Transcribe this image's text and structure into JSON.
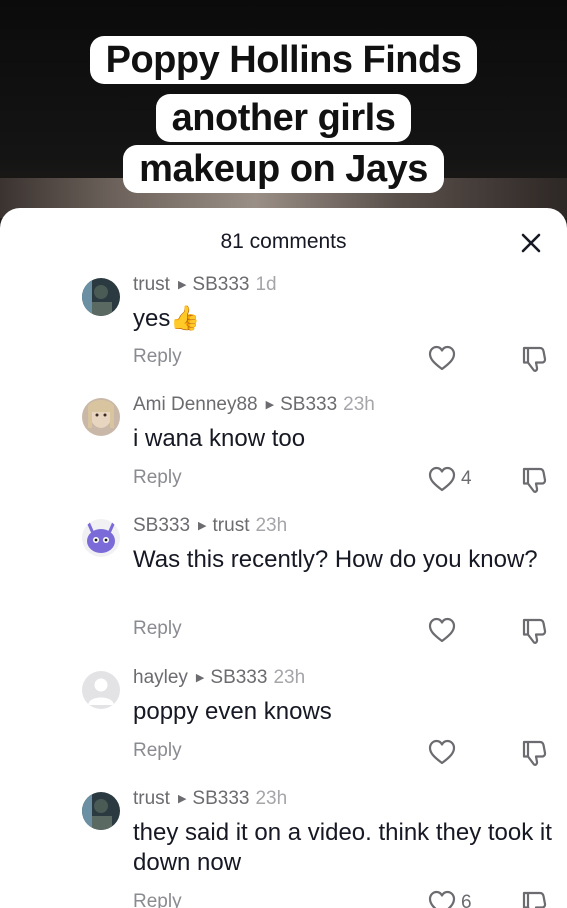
{
  "video": {
    "caption_lines": [
      "Poppy Hollins Finds",
      "another girls",
      "makeup on Jays"
    ]
  },
  "sheet": {
    "title": "81 comments"
  },
  "comments": [
    {
      "user": "trust",
      "reply_to": "SB333",
      "time": "1d",
      "text": "yes👍",
      "reply_label": "Reply",
      "likes": ""
    },
    {
      "user": "Ami Denney88",
      "reply_to": "SB333",
      "time": "23h",
      "text": "i wana know too",
      "reply_label": "Reply",
      "likes": "4"
    },
    {
      "user": "SB333",
      "reply_to": "trust",
      "time": "23h",
      "text": "Was this recently? How do you know?",
      "reply_label": "Reply",
      "likes": ""
    },
    {
      "user": "hayley",
      "reply_to": "SB333",
      "time": "23h",
      "text": "poppy even knows",
      "reply_label": "Reply",
      "likes": ""
    },
    {
      "user": "trust",
      "reply_to": "SB333",
      "time": "23h",
      "text": "they said it on a video. think they took it down now",
      "reply_label": "Reply",
      "likes": "6"
    }
  ]
}
